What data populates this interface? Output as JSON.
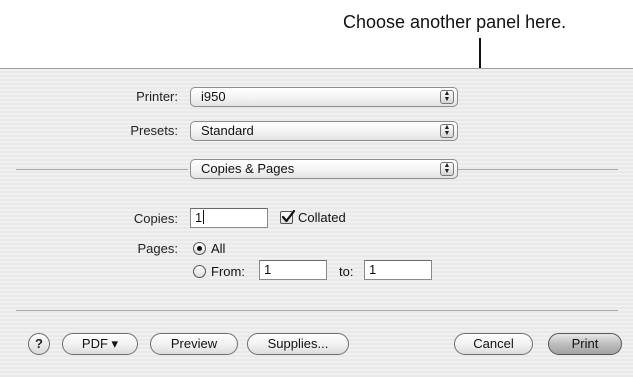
{
  "annotation": {
    "callout_text": "Choose another panel here."
  },
  "dialog": {
    "printer": {
      "label": "Printer:",
      "value": "i950"
    },
    "presets": {
      "label": "Presets:",
      "value": "Standard"
    },
    "panel": {
      "value": "Copies & Pages"
    },
    "copies": {
      "label": "Copies:",
      "value": "1",
      "collated_label": "Collated",
      "collated_checked": true
    },
    "pages": {
      "label": "Pages:",
      "all_label": "All",
      "from_label": "From:",
      "from_value": "1",
      "to_label": "to:",
      "to_value": "1",
      "selected": "All"
    },
    "buttons": {
      "help": "?",
      "pdf": "PDF ▾",
      "preview": "Preview",
      "supplies": "Supplies...",
      "cancel": "Cancel",
      "print": "Print"
    }
  }
}
